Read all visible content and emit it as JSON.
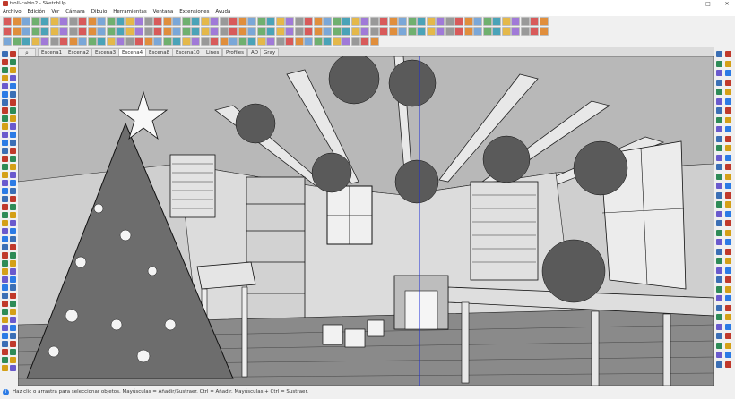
{
  "window": {
    "title": "troll-cabin2 - SketchUp",
    "minimize": "–",
    "maximize": "□",
    "close": "✕"
  },
  "menu": [
    "Archivo",
    "Edición",
    "Ver",
    "Cámara",
    "Dibujo",
    "Herramientas",
    "Ventana",
    "Extensiones",
    "Ayuda"
  ],
  "scenes": [
    "Escena1",
    "Escena2",
    "Escena3",
    "Escena4",
    "Escena8",
    "Escena10",
    "Lines",
    "Profiles",
    "AO",
    "Gray"
  ],
  "active_scene": "Escena4",
  "status": {
    "info_icon": "i",
    "message": "Haz clic o arrastra para seleccionar objetos. Mayúsculas = Añadir/Sustraer. Ctrl = Añadir. Mayúsculas + Ctrl = Sustraer."
  },
  "colors": {
    "accent": "#2c7be5",
    "viewport_bg": "#d9d9d9",
    "axis_blue": "#1a2bd6"
  }
}
